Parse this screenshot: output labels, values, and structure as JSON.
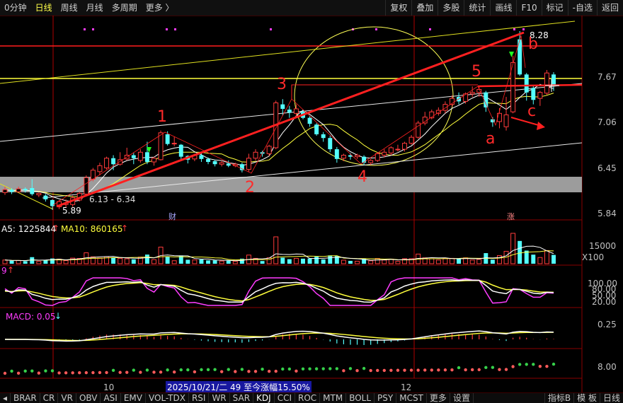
{
  "toolbar": {
    "left_tabs": [
      "0分钟",
      "日线",
      "周线",
      "月线",
      "多周期",
      "更多 〉"
    ],
    "active_tab": "日线",
    "right_buttons": [
      "复权",
      "叠加",
      "多股",
      "统计",
      "画线",
      "F10",
      "标记",
      "-自选",
      "返回"
    ]
  },
  "price_axis": [
    "8.28",
    "7.67",
    "7.06",
    "6.45",
    "5.84"
  ],
  "price_annotations": {
    "high": "8.28",
    "low": "5.89",
    "range": "6.13 - 6.34"
  },
  "wave_labels": [
    "1",
    "2",
    "3",
    "4",
    "5",
    "a",
    "b",
    "c"
  ],
  "markers": {
    "cai": "财",
    "zhang": "涨"
  },
  "volume": {
    "ma5_label": "A5: 1225844",
    "ma10_label": "MA10: 860165",
    "axis_top": "15000",
    "unit": "X100"
  },
  "kdj": {
    "label": "9",
    "axis": [
      "100.00",
      "80.00",
      "50.00",
      "20.00"
    ]
  },
  "macd": {
    "label": "MACD: 0.05",
    "axis": "0.25"
  },
  "sub5": {
    "axis": "8.00"
  },
  "xaxis": {
    "labels": [
      "10",
      "12"
    ],
    "info": "2025/10/21/二 49 至今涨幅15.50%"
  },
  "bottom_tabs": [
    "BRAR",
    "CR",
    "VR",
    "OBV",
    "ASI",
    "EMV",
    "VOL-TDX",
    "RSI",
    "WR",
    "SAR",
    "KDJ",
    "CCI",
    "ROC",
    "MTM",
    "BOLL",
    "PSY",
    "MCST",
    "更多",
    "设置"
  ],
  "bottom_right": [
    "指标B",
    "模 板"
  ],
  "bottom_right2": [
    "日线"
  ],
  "colors": {
    "up": "#ff3b3b",
    "down": "#54ffff",
    "ma5": "#ffffff",
    "ma10": "#ffff3c",
    "ma20": "#ff3cff",
    "ellipse": "#ffff55",
    "trend": "#ff2020"
  },
  "chart_data": {
    "type": "candlestick",
    "y_range": [
      5.84,
      8.28
    ],
    "candles": [
      [
        6.12,
        6.16,
        6.2,
        6.09
      ],
      [
        6.16,
        6.13,
        6.18,
        6.1
      ],
      [
        6.13,
        6.17,
        6.2,
        6.12
      ],
      [
        6.17,
        6.15,
        6.19,
        6.12
      ],
      [
        6.18,
        6.1,
        6.3,
        6.08
      ],
      [
        6.09,
        6.11,
        6.12,
        6.06
      ],
      [
        6.08,
        6.03,
        6.1,
        6.0
      ],
      [
        6.02,
        5.94,
        6.03,
        5.89
      ],
      [
        5.93,
        6.0,
        6.02,
        5.9
      ],
      [
        5.96,
        5.98,
        6.03,
        5.92
      ],
      [
        5.96,
        6.05,
        6.08,
        5.93
      ],
      [
        6.02,
        6.11,
        6.13,
        6.0
      ],
      [
        6.1,
        6.32,
        6.35,
        6.08
      ],
      [
        6.3,
        6.42,
        6.45,
        6.27
      ],
      [
        6.4,
        6.48,
        6.52,
        6.35
      ],
      [
        6.45,
        6.58,
        6.6,
        6.43
      ],
      [
        6.58,
        6.5,
        6.62,
        6.42
      ],
      [
        6.5,
        6.56,
        6.66,
        6.48
      ],
      [
        6.57,
        6.62,
        6.72,
        6.55
      ],
      [
        6.62,
        6.58,
        6.65,
        6.5
      ],
      [
        6.55,
        6.66,
        6.7,
        6.52
      ],
      [
        6.66,
        6.53,
        6.8,
        6.5
      ],
      [
        6.53,
        6.58,
        6.6,
        6.48
      ],
      [
        6.56,
        6.92,
        6.95,
        6.55
      ],
      [
        6.9,
        6.77,
        6.94,
        6.75
      ],
      [
        6.78,
        6.78,
        6.87,
        6.74
      ],
      [
        6.76,
        6.6,
        6.77,
        6.57
      ],
      [
        6.61,
        6.56,
        6.62,
        6.51
      ],
      [
        6.57,
        6.62,
        6.64,
        6.54
      ],
      [
        6.62,
        6.57,
        6.66,
        6.53
      ],
      [
        6.57,
        6.53,
        6.59,
        6.5
      ],
      [
        6.54,
        6.5,
        6.56,
        6.47
      ],
      [
        6.5,
        6.52,
        6.55,
        6.47
      ],
      [
        6.51,
        6.48,
        6.55,
        6.46
      ],
      [
        6.48,
        6.5,
        6.52,
        6.46
      ],
      [
        6.5,
        6.42,
        6.52,
        6.39
      ],
      [
        6.43,
        6.58,
        6.64,
        6.4
      ],
      [
        6.58,
        6.66,
        6.7,
        6.55
      ],
      [
        6.66,
        6.64,
        6.68,
        6.6
      ],
      [
        6.64,
        6.74,
        6.76,
        6.61
      ],
      [
        6.72,
        7.32,
        7.35,
        6.7
      ],
      [
        7.3,
        7.24,
        7.37,
        7.15
      ],
      [
        7.23,
        7.19,
        7.28,
        7.12
      ],
      [
        7.18,
        7.24,
        7.3,
        7.12
      ],
      [
        7.2,
        7.12,
        7.23,
        7.1
      ],
      [
        7.12,
        7.04,
        7.14,
        7.0
      ],
      [
        7.03,
        6.9,
        7.05,
        6.88
      ],
      [
        6.9,
        6.85,
        6.93,
        6.8
      ],
      [
        6.85,
        6.7,
        6.88,
        6.66
      ],
      [
        6.7,
        6.57,
        6.73,
        6.52
      ],
      [
        6.58,
        6.62,
        6.64,
        6.54
      ],
      [
        6.62,
        6.6,
        6.65,
        6.56
      ],
      [
        6.6,
        6.62,
        6.64,
        6.57
      ],
      [
        6.6,
        6.52,
        6.62,
        6.49
      ],
      [
        6.52,
        6.55,
        6.57,
        6.49
      ],
      [
        6.55,
        6.64,
        6.66,
        6.53
      ],
      [
        6.62,
        6.66,
        6.7,
        6.59
      ],
      [
        6.65,
        6.72,
        6.74,
        6.62
      ],
      [
        6.7,
        6.7,
        6.76,
        6.67
      ],
      [
        6.7,
        6.78,
        6.8,
        6.67
      ],
      [
        6.78,
        6.86,
        6.89,
        6.76
      ],
      [
        6.86,
        7.05,
        7.08,
        6.84
      ],
      [
        7.05,
        7.13,
        7.2,
        7.02
      ],
      [
        7.12,
        7.2,
        7.23,
        7.1
      ],
      [
        7.18,
        7.22,
        7.26,
        7.15
      ],
      [
        7.22,
        7.3,
        7.34,
        7.18
      ],
      [
        7.3,
        7.38,
        7.42,
        7.27
      ],
      [
        7.4,
        7.34,
        7.46,
        7.3
      ],
      [
        7.34,
        7.44,
        7.46,
        7.31
      ],
      [
        7.44,
        7.46,
        7.54,
        7.4
      ],
      [
        7.46,
        7.5,
        7.55,
        7.4
      ],
      [
        7.46,
        7.26,
        7.48,
        7.2
      ],
      [
        7.1,
        7.06,
        7.13,
        7.0
      ],
      [
        7.07,
        7.18,
        7.25,
        6.98
      ],
      [
        7.0,
        7.16,
        7.4,
        6.95
      ],
      [
        7.2,
        7.86,
        7.95,
        7.18
      ],
      [
        8.17,
        7.7,
        8.28,
        7.68
      ],
      [
        7.7,
        7.46,
        7.72,
        7.35
      ],
      [
        7.52,
        7.36,
        7.55,
        7.3
      ],
      [
        7.38,
        7.46,
        7.48,
        7.28
      ],
      [
        7.45,
        7.72,
        7.76,
        7.43
      ],
      [
        7.7,
        7.55,
        7.73,
        7.48
      ]
    ]
  }
}
